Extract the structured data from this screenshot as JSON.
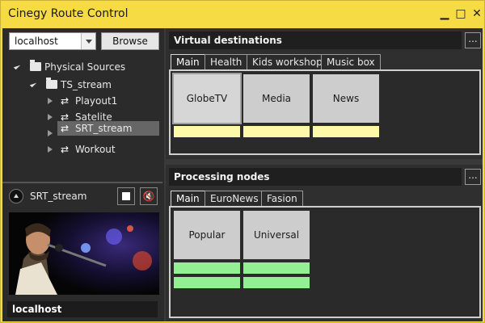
{
  "window": {
    "title": "Cinegy Route Control",
    "controls": {
      "minimize": "▁",
      "maximize": "□",
      "close": "✕"
    }
  },
  "left_panel": {
    "host_select": {
      "value": "localhost"
    },
    "browse_label": "Browse",
    "tree": {
      "root": {
        "label": "Physical Sources"
      },
      "child": {
        "label": "TS_stream"
      },
      "items": [
        {
          "label": "Playout1",
          "selected": false
        },
        {
          "label": "Satelite",
          "selected": false
        },
        {
          "label": "SRT_stream",
          "selected": true
        },
        {
          "label": "Workout",
          "selected": false
        }
      ]
    },
    "preview": {
      "name": "SRT_stream",
      "host": "localhost"
    }
  },
  "virtual_destinations": {
    "title": "Virtual destinations",
    "more_label": "...",
    "tabs": [
      "Main",
      "Health",
      "Kids workshop",
      "Music box"
    ],
    "active_tab": "Main",
    "cards": [
      {
        "label": "GlobeTV",
        "selected": true
      },
      {
        "label": "Media",
        "selected": false
      },
      {
        "label": "News",
        "selected": false
      }
    ]
  },
  "processing_nodes": {
    "title": "Processing nodes",
    "more_label": "...",
    "tabs": [
      "Main",
      "EuroNews",
      "Fasion"
    ],
    "active_tab": "Main",
    "cards": [
      {
        "label": "Popular"
      },
      {
        "label": "Universal"
      }
    ]
  },
  "colors": {
    "accent": "#f6db45",
    "status_yellow": "#fcfaa8",
    "status_green": "#92f092"
  }
}
